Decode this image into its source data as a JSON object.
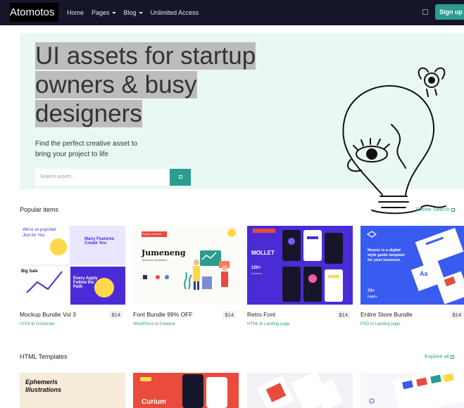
{
  "navbar": {
    "brand": "Atomotos",
    "links": [
      {
        "label": "Home",
        "has_dropdown": false
      },
      {
        "label": "Pages",
        "has_dropdown": true
      },
      {
        "label": "Blog",
        "has_dropdown": true
      },
      {
        "label": "Unlimited Access",
        "has_dropdown": false
      }
    ],
    "signup_label": "Sign up"
  },
  "hero": {
    "title_lines": [
      "UI assets for startup",
      "owners & busy",
      "designers"
    ],
    "subtitle_lines": [
      "Find the perfect creative asset to",
      "bring your project to life"
    ],
    "search_placeholder": "Search assets ..."
  },
  "popular": {
    "title": "Popular items",
    "link_label": "Refine Search",
    "items": [
      {
        "title": "Mockup Bundle Vol 3",
        "price": "$14",
        "type": "UI Kit",
        "in": "in",
        "category": "Corporate",
        "thumb_text": [
          "We're so psyched",
          "Just for You",
          "Many Features Create You",
          "Big Sale",
          "Every Apply Follow the Path"
        ]
      },
      {
        "title": "Font Bundle 99% OFF",
        "price": "$14",
        "type": "WordPress",
        "in": "in",
        "category": "Creative",
        "thumb_text": [
          "Jumeneng",
          "Business Illustration",
          "Screen Creator"
        ]
      },
      {
        "title": "Retro Font",
        "price": "$14",
        "type": "HTML",
        "in": "in",
        "category": "Landing page",
        "thumb_text": [
          "MOLLET",
          "120+",
          "Screens"
        ]
      },
      {
        "title": "Entire Store Bundle",
        "price": "$14",
        "type": "PSD",
        "in": "in",
        "category": "Landing page",
        "thumb_text": [
          "Neonic is a digital style guide template for your business.",
          "70+",
          "pages",
          "Aa"
        ]
      }
    ]
  },
  "templates": {
    "title": "HTML Templates",
    "link_label": "Explore all",
    "thumb_text": [
      "Ephemeris",
      "Illustrations",
      "Curium"
    ]
  },
  "colors": {
    "accent": "#2a9d8f",
    "navbar": "#16162a",
    "hero_bg": "#eaf8f5",
    "purple": "#4b2bd6",
    "blue": "#3a5bf0"
  }
}
